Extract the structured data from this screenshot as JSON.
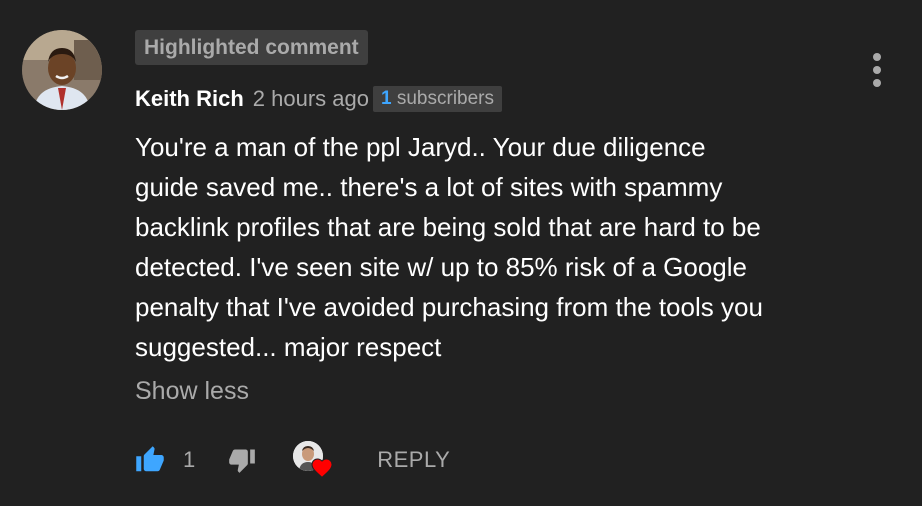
{
  "comment": {
    "highlight_label": "Highlighted comment",
    "author": "Keith Rich",
    "time": "2 hours ago",
    "subscribers_count": "1",
    "subscribers_label": "subscribers",
    "text": "You're a man of the ppl Jaryd.. Your due diligence\nguide saved me.. there's a lot of sites with spammy\nbacklink profiles that are being sold that are hard to be\ndetected. I've seen site w/ up to 85% risk of a Google\npenalty that I've avoided purchasing from the tools you\nsuggested... major respect",
    "show_less": "Show less"
  },
  "actions": {
    "like_count": "1",
    "reply_label": "REPLY",
    "like_icon": "thumbs-up-icon",
    "dislike_icon": "thumbs-down-icon",
    "heart_icon": "creator-heart-icon"
  },
  "colors": {
    "background": "#212121",
    "accent": "#3ea6ff",
    "secondary_text": "#aaaaaa",
    "heart": "#ff0000"
  }
}
